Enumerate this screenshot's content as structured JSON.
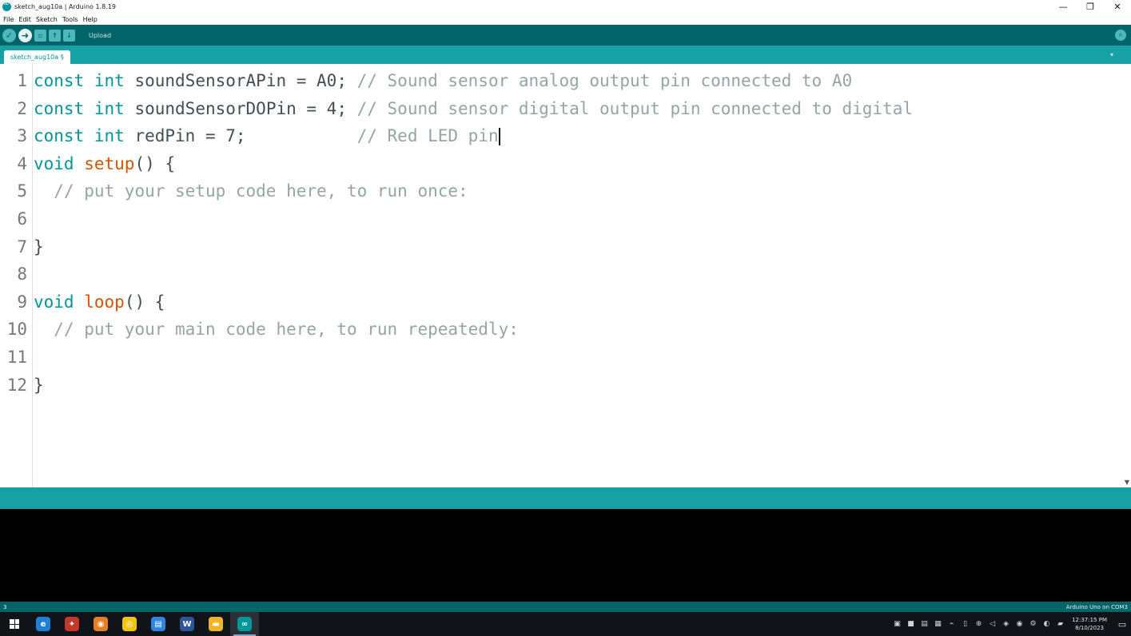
{
  "window": {
    "title": "sketch_aug10a | Arduino 1.8.19",
    "minimize_glyph": "—",
    "maximize_glyph": "❐",
    "close_glyph": "✕"
  },
  "menu": [
    "File",
    "Edit",
    "Sketch",
    "Tools",
    "Help"
  ],
  "toolbar": {
    "hover_label": "Upload",
    "icons": [
      "verify-icon",
      "upload-icon",
      "new-icon",
      "open-icon",
      "save-icon",
      "serial-monitor-icon"
    ]
  },
  "tab": {
    "label": "sketch_aug10a §"
  },
  "editor": {
    "lines": [
      {
        "num": "1",
        "segments": [
          [
            "kw",
            "const"
          ],
          [
            "p",
            " "
          ],
          [
            "kw",
            "int"
          ],
          [
            "p",
            " soundSensorAPin = A0; "
          ],
          [
            "cm",
            "// Sound sensor analog output pin connected to A0"
          ]
        ]
      },
      {
        "num": "2",
        "segments": [
          [
            "kw",
            "const"
          ],
          [
            "p",
            " "
          ],
          [
            "kw",
            "int"
          ],
          [
            "p",
            " soundSensorDOPin = 4; "
          ],
          [
            "cm",
            "// Sound sensor digital output pin connected to digital"
          ]
        ]
      },
      {
        "num": "3",
        "segments": [
          [
            "kw",
            "const"
          ],
          [
            "p",
            " "
          ],
          [
            "kw",
            "int"
          ],
          [
            "p",
            " redPin = 7;           "
          ],
          [
            "cm",
            "// Red LED pin"
          ]
        ],
        "cursor": true
      },
      {
        "num": "4",
        "segments": [
          [
            "kw",
            "void"
          ],
          [
            "p",
            " "
          ],
          [
            "fn",
            "setup"
          ],
          [
            "p",
            "() {"
          ]
        ]
      },
      {
        "num": "5",
        "segments": [
          [
            "p",
            "  "
          ],
          [
            "cm",
            "// put your setup code here, to run once:"
          ]
        ]
      },
      {
        "num": "6",
        "segments": []
      },
      {
        "num": "7",
        "segments": [
          [
            "p",
            "}"
          ]
        ]
      },
      {
        "num": "8",
        "segments": []
      },
      {
        "num": "9",
        "segments": [
          [
            "kw",
            "void"
          ],
          [
            "p",
            " "
          ],
          [
            "fn",
            "loop"
          ],
          [
            "p",
            "() {"
          ]
        ]
      },
      {
        "num": "10",
        "segments": [
          [
            "p",
            "  "
          ],
          [
            "cm",
            "// put your main code here, to run repeatedly:"
          ]
        ]
      },
      {
        "num": "11",
        "segments": []
      },
      {
        "num": "12",
        "segments": [
          [
            "p",
            "}"
          ]
        ]
      }
    ]
  },
  "status": {
    "line_number": "3",
    "board": "Arduino Uno on COM3"
  },
  "taskbar": {
    "clock_time": "12:37:15 PM",
    "clock_date": "8/10/2023",
    "apps": [
      {
        "name": "edge-icon",
        "color": "#1f7fd0",
        "glyph": "e"
      },
      {
        "name": "app-icon-2",
        "color": "#c0392b",
        "glyph": "✦"
      },
      {
        "name": "app-icon-3",
        "color": "#e67e22",
        "glyph": "◉"
      },
      {
        "name": "chrome-icon",
        "color": "#f1c40f",
        "glyph": "◎"
      },
      {
        "name": "app-icon-5",
        "color": "#2e86de",
        "glyph": "▤"
      },
      {
        "name": "word-icon",
        "color": "#2b579a",
        "glyph": "W"
      },
      {
        "name": "explorer-icon",
        "color": "#f0b429",
        "glyph": "▬"
      },
      {
        "name": "arduino-icon",
        "color": "#00979c",
        "glyph": "∞",
        "active": true
      }
    ]
  }
}
